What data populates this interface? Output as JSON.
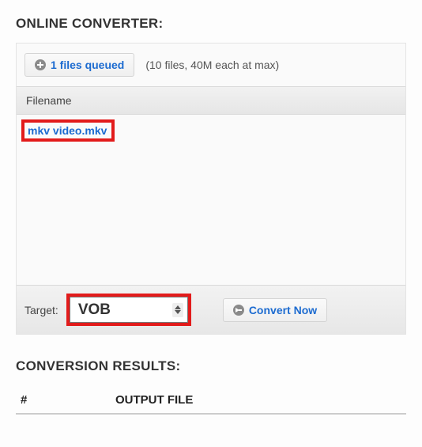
{
  "converter": {
    "title": "ONLINE CONVERTER:",
    "queue_button_label": "1 files queued",
    "limits_hint": "(10 files, 40M each at max)",
    "filename_header": "Filename",
    "files": [
      {
        "name": "mkv video.mkv"
      }
    ],
    "target_label": "Target:",
    "target_selected": "VOB",
    "convert_button_label": "Convert Now"
  },
  "results": {
    "title": "CONVERSION RESULTS:",
    "col_index": "#",
    "col_output": "OUTPUT FILE"
  }
}
